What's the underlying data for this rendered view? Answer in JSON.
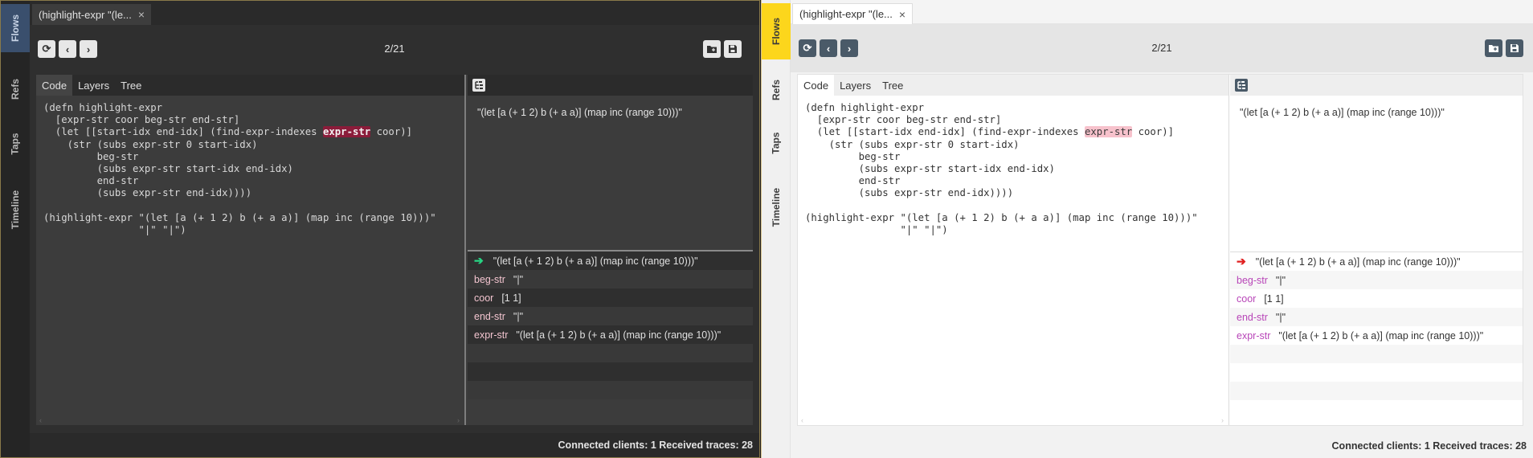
{
  "sidebar": {
    "tabs": [
      {
        "label": "Flows"
      },
      {
        "label": "Refs"
      },
      {
        "label": "Taps"
      },
      {
        "label": "Timeline"
      }
    ]
  },
  "flow_tab": {
    "label": "(highlight-expr \"(le...",
    "close": "×"
  },
  "toolbar": {
    "counter": "2/21",
    "reload_icon": "⟳",
    "prev_icon": "‹",
    "next_icon": "›"
  },
  "code_tabs": [
    {
      "label": "Code"
    },
    {
      "label": "Layers"
    },
    {
      "label": "Tree"
    }
  ],
  "code": {
    "lines": [
      "(defn highlight-expr",
      "  [expr-str coor beg-str end-str]",
      "  (let [[start-idx end-idx] (find-expr-indexes ",
      "    (str (subs expr-str 0 start-idx)",
      "         beg-str",
      "         (subs expr-str start-idx end-idx)",
      "         end-str",
      "         (subs expr-str end-idx))))",
      "",
      "(highlight-expr \"(let [a (+ 1 2) b (+ a a)] (map inc (range 10)))\"",
      "                \"|\" \"|\")"
    ],
    "highlight": "expr-str",
    "line3_tail": " coor)]"
  },
  "result": {
    "value": "\"(let [a (+ 1 2) b (+ a a)] (map inc (range 10)))\""
  },
  "locals": {
    "return_value": "\"(let [a (+ 1 2) b (+ a a)] (map inc (range 10)))\"",
    "items": [
      {
        "name": "beg-str",
        "value": "\"|\""
      },
      {
        "name": "coor",
        "value": "[1 1]"
      },
      {
        "name": "end-str",
        "value": "\"|\""
      },
      {
        "name": "expr-str",
        "value": "\"(let [a (+ 1 2) b (+ a a)] (map inc (range 10)))\""
      }
    ]
  },
  "status": {
    "text": "Connected clients: 1 Received traces: 28"
  },
  "colors": {
    "dark_accent": "#3a4f6d",
    "light_accent": "#fcd61c",
    "dark_return_arrow": "#27d483",
    "light_return_arrow": "#e02020"
  }
}
